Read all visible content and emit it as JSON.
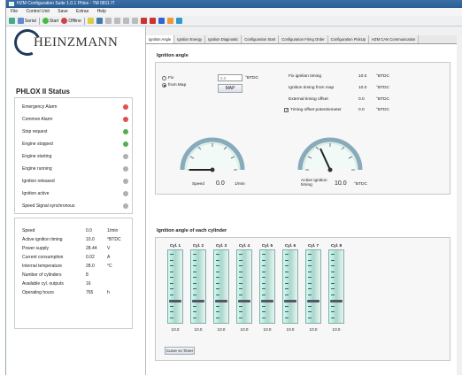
{
  "window": {
    "title": "HZM Configuration Suite 1.0.1 Phlox - TM 0811 IT"
  },
  "menu": [
    "File",
    "Control Unit",
    "Save",
    "Extras",
    "Help"
  ],
  "toolbar": {
    "items": [
      "Serial",
      "Start",
      "Offline"
    ]
  },
  "logo": {
    "text": "HEINZMANN"
  },
  "status": {
    "title": "PHLOX II Status",
    "rows": [
      {
        "label": "Emergency Alarm",
        "color": "#e05050"
      },
      {
        "label": "Common Alarm",
        "color": "#e05050"
      },
      {
        "label": "Stop request",
        "color": "#50b050"
      },
      {
        "label": "Engine stopped",
        "color": "#50b050"
      },
      {
        "label": "Engine starting",
        "color": "#b0b0b0"
      },
      {
        "label": "Engine running",
        "color": "#b0b0b0"
      },
      {
        "label": "Ignition released",
        "color": "#b0b0b0"
      },
      {
        "label": "Ignition active",
        "color": "#b0b0b0"
      },
      {
        "label": "Speed Signal synchronous",
        "color": "#b0b0b0"
      }
    ]
  },
  "values": [
    {
      "label": "Speed",
      "value": "0.0",
      "unit": "1/min"
    },
    {
      "label": "Active ignition timing",
      "value": "10.0",
      "unit": "°BTDC"
    },
    {
      "label": "Power supply",
      "value": "28.44",
      "unit": "V"
    },
    {
      "label": "Current consumption",
      "value": "0.02",
      "unit": "A"
    },
    {
      "label": "Internal temperature",
      "value": "28.0",
      "unit": "°C"
    },
    {
      "label": "Number of cylinders",
      "value": "8",
      "unit": ""
    },
    {
      "label": "Available cyl. outputs",
      "value": "16",
      "unit": ""
    },
    {
      "label": "Operating hours",
      "value": "765",
      "unit": "h"
    }
  ],
  "tabs": [
    "Ignition Angle",
    "Ignition Energy",
    "Ignition Diagnostic",
    "Configuration Start",
    "Configuration Firing Order",
    "Configuration PickUp",
    "HZM CAN Communication"
  ],
  "ignition": {
    "title": "Ignition angle",
    "fix_label": "Fix",
    "map_label": "from Map",
    "input_value": "0.0",
    "input_unit": "°BTDC",
    "map_button": "MAP",
    "right": [
      {
        "label": "Fix ignition timing",
        "value": "10.0",
        "unit": "°BTDC"
      },
      {
        "label": "Ignition timing from map",
        "value": "10.0",
        "unit": "°BTDC"
      },
      {
        "label": "External timing offset",
        "value": "0.0",
        "unit": "°BTDC"
      },
      {
        "label": "Timing offset potentiometer",
        "value": "0.0",
        "unit": "°BTDC",
        "checked": true
      }
    ],
    "gauge1": {
      "label": "Speed",
      "value": "0.0",
      "unit": "1/min",
      "needle_deg": -90
    },
    "gauge2": {
      "label": "Active ignition timing",
      "value": "10.0",
      "unit": "°BTDC",
      "needle_deg": -25
    }
  },
  "cylinders": {
    "title": "Ignition angle of each cylinder",
    "items": [
      {
        "name": "Cyl. 1",
        "value": "10.0"
      },
      {
        "name": "Cyl. 2",
        "value": "10.0"
      },
      {
        "name": "Cyl. 3",
        "value": "10.0"
      },
      {
        "name": "Cyl. 4",
        "value": "10.0"
      },
      {
        "name": "Cyl. 5",
        "value": "10.0"
      },
      {
        "name": "Cyl. 6",
        "value": "10.0"
      },
      {
        "name": "Cyl. 7",
        "value": "10.0"
      },
      {
        "name": "Cyl. 8",
        "value": "10.0"
      }
    ],
    "curve_button": "Curve vs Timer"
  }
}
